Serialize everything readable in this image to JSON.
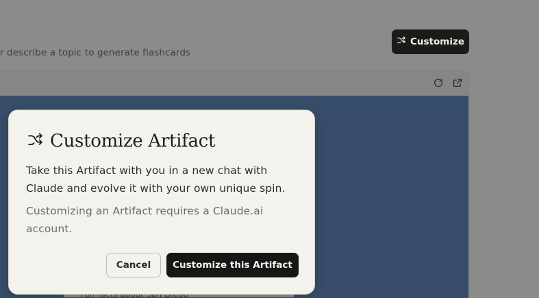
{
  "background": {
    "description_text": "r describe a topic to generate flashcards",
    "customize_button_label": "Customize",
    "card_text": "Fun facts about San Diego",
    "colors": {
      "artifact_bg": "#374d69",
      "button_bg": "#1b1b1a",
      "overlay": "#8a8a88"
    },
    "toolbar_icons": [
      "refresh-icon",
      "open-external-icon"
    ]
  },
  "modal": {
    "title": "Customize Artifact",
    "title_icon": "shuffle-icon",
    "body": "Take this Artifact with you in a new chat with Claude and evolve it with your own unique spin.",
    "note": "Customizing an Artifact requires a Claude.ai account.",
    "cancel_label": "Cancel",
    "confirm_label": "Customize this Artifact",
    "colors": {
      "background": "#f4f2ec",
      "primary_button": "#161615"
    }
  }
}
